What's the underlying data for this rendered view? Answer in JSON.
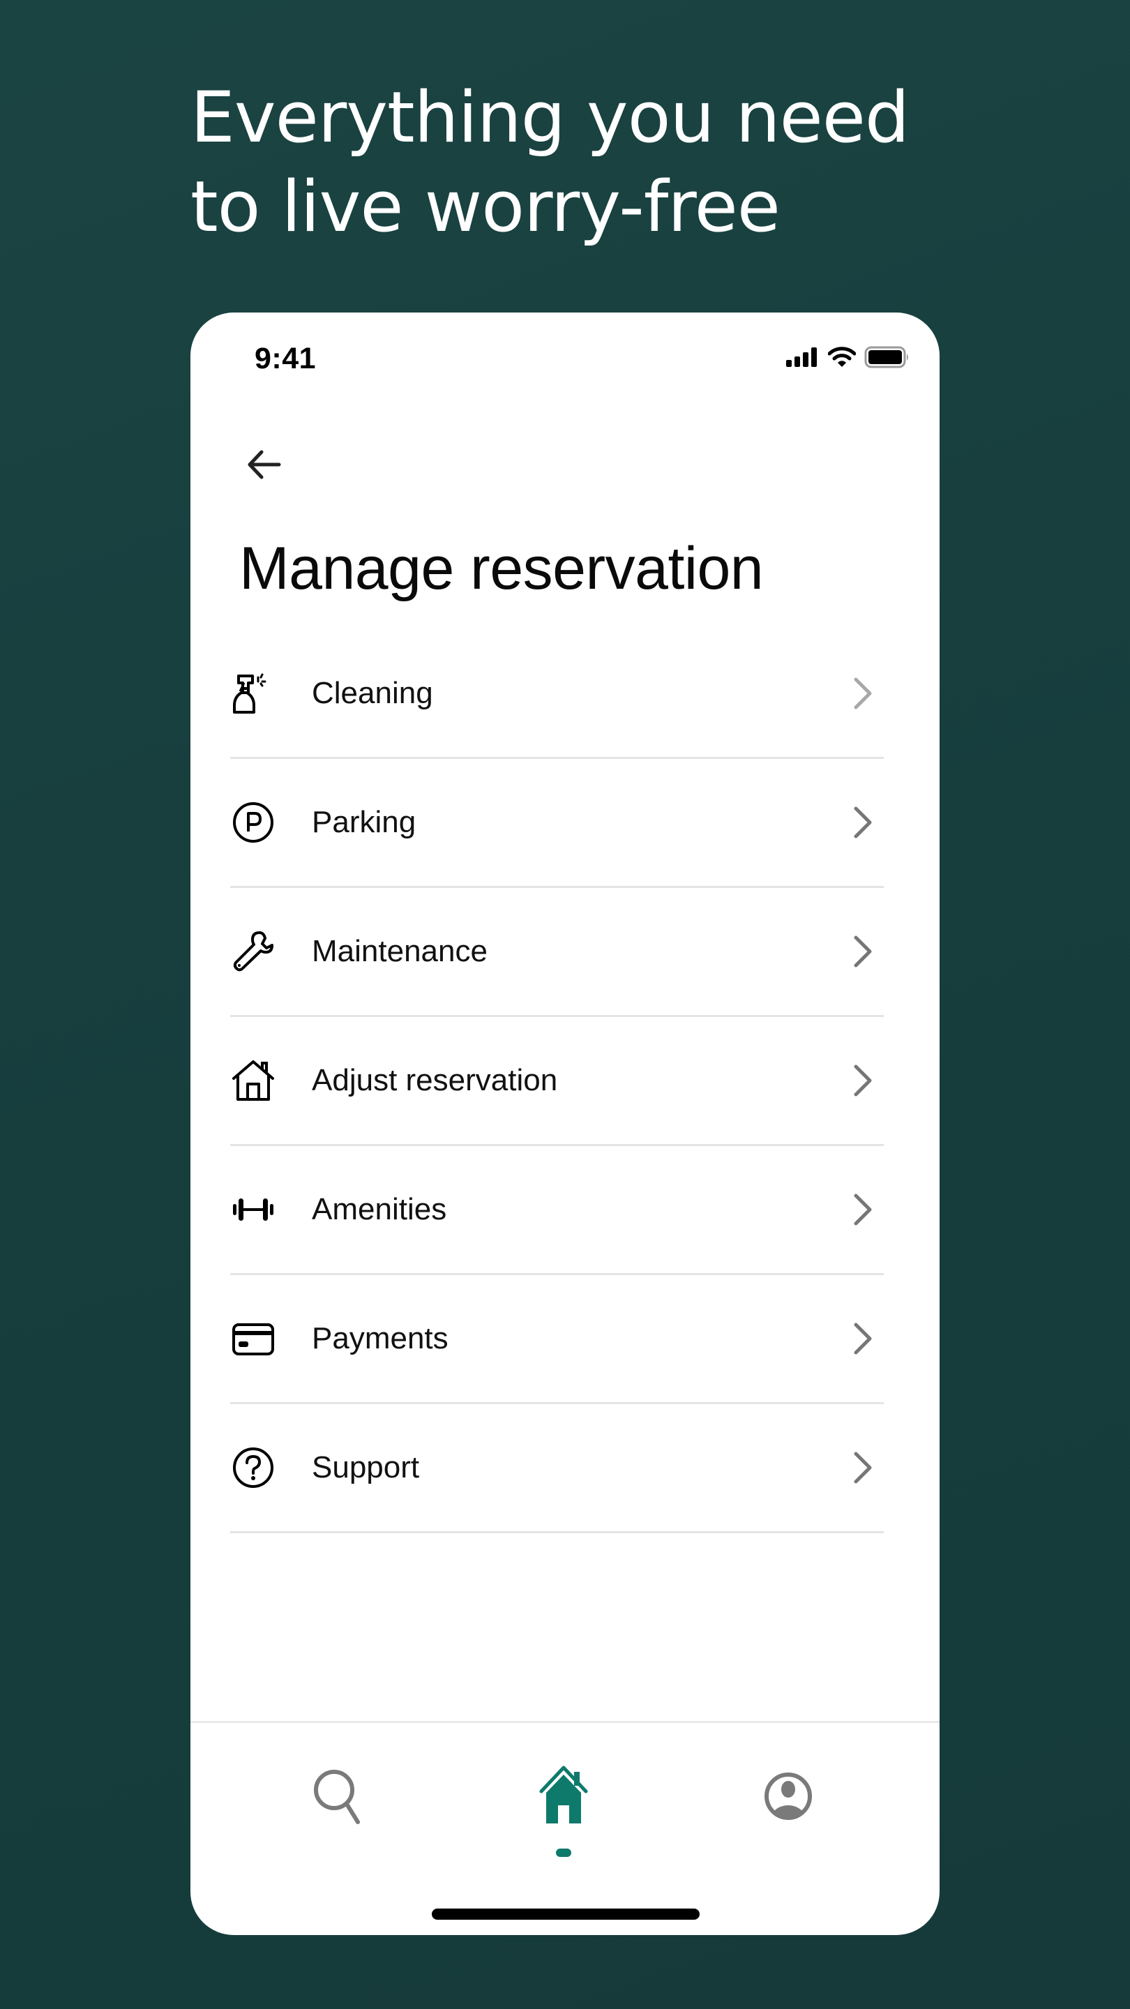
{
  "promo": {
    "headline_line1": "Everything you need",
    "headline_line2": "to live worry-free"
  },
  "status_bar": {
    "time": "9:41",
    "icons": [
      "cellular-signal-icon",
      "wifi-icon",
      "battery-icon"
    ]
  },
  "header": {
    "back_icon": "arrow-left-icon",
    "title": "Manage reservation"
  },
  "menu": {
    "items": [
      {
        "label": "Cleaning",
        "icon": "spray-bottle-icon"
      },
      {
        "label": "Parking",
        "icon": "parking-icon"
      },
      {
        "label": "Maintenance",
        "icon": "wrench-icon"
      },
      {
        "label": "Adjust reservation",
        "icon": "house-icon"
      },
      {
        "label": "Amenities",
        "icon": "dumbbell-icon"
      },
      {
        "label": "Payments",
        "icon": "credit-card-icon"
      },
      {
        "label": "Support",
        "icon": "question-circle-icon"
      }
    ],
    "chevron_icon": "chevron-right-icon"
  },
  "bottom_nav": {
    "items": [
      {
        "name": "search",
        "icon": "search-icon",
        "active": false
      },
      {
        "name": "home",
        "icon": "home-icon",
        "active": true
      },
      {
        "name": "profile",
        "icon": "profile-icon",
        "active": false
      }
    ]
  },
  "colors": {
    "background": "#173d3d",
    "accent": "#0e7a6b",
    "inactive_icon": "#7a7a7a",
    "chevron": "#767676",
    "divider": "#e4e4e4",
    "text": "#111111"
  }
}
